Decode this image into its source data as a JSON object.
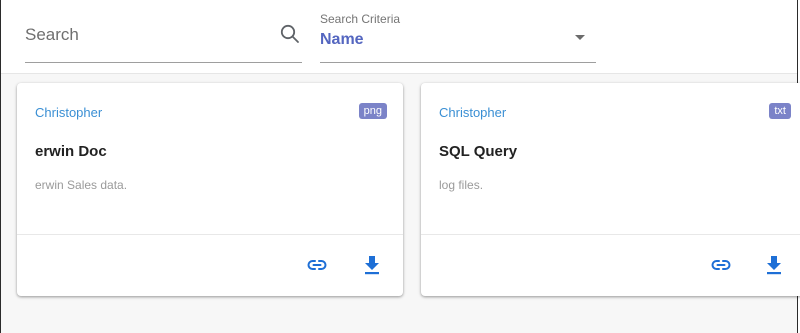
{
  "search": {
    "placeholder": "Search",
    "criteria_label": "Search Criteria",
    "criteria_value": "Name"
  },
  "colors": {
    "accent": "#5466c0",
    "author": "#3a8fd4",
    "badge": "#7b83c8",
    "action_icon": "#1e6fd6"
  },
  "cards": [
    {
      "author": "Christopher",
      "type": "png",
      "title": "erwin Doc",
      "description": "erwin Sales data.",
      "icons": [
        "link-icon",
        "download-icon"
      ]
    },
    {
      "author": "Christopher",
      "type": "txt",
      "title": "SQL Query",
      "description": "log files.",
      "icons": [
        "link-icon",
        "download-icon"
      ]
    }
  ]
}
